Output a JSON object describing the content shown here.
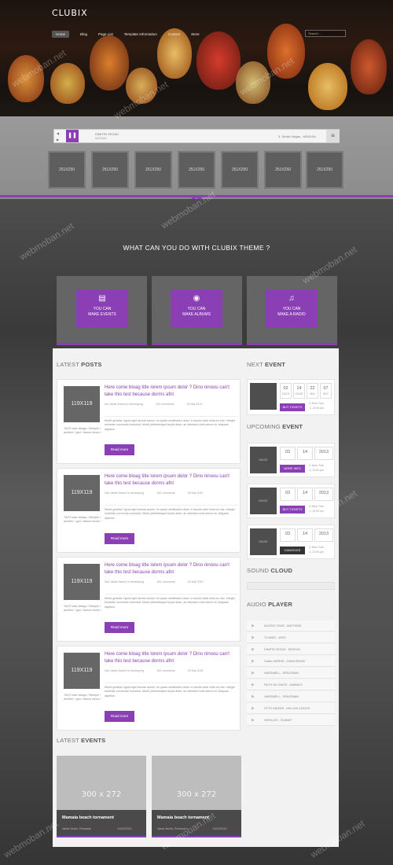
{
  "header": {
    "logo": "CLUBIX",
    "nav": [
      "Home",
      "Blog",
      "Page List",
      "Template Information",
      "Contact",
      "More"
    ],
    "search_placeholder": "Search..."
  },
  "player": {
    "artist": "DIMITRI VEGAS",
    "track": "MOGUAI",
    "now_playing": "3. Dimitri Vegas - MOGUAI"
  },
  "thumbs": [
    "251X250",
    "251X250",
    "251X250",
    "251X250",
    "251X250",
    "251X250",
    "251X250"
  ],
  "headline": "WHAT CAN YOU DO WITH CLUBIX THEME ?",
  "features": [
    {
      "icon": "news-icon",
      "line1": "YOU CAN",
      "line2": "MAKE EVENTS"
    },
    {
      "icon": "disc-icon",
      "line1": "YOU CAN",
      "line2": "MAKE ALBUMS"
    },
    {
      "icon": "music-note-icon",
      "line1": "YOU CAN",
      "line2": "MAKE A RADIO"
    }
  ],
  "latest_posts": {
    "heading_light": "LATEST",
    "heading_bold": "POSTS",
    "posts": [
      {
        "img": "119X119",
        "title": "Here come bloag title lorem ipsum dolor ? Dino ninoou can't take this test because dorms afnt",
        "author": "Ion Vasile Daniel in developing",
        "comments": "100 comments",
        "date": "25 Mai 2013",
        "text": "Morbi gravida, ligula eget lacinia auctor, mi quam vestibulum dolor, in iaculis ante nulla eu nisi. Integer molestie commodo euismod. Morbi pellentesque turpis diam, ac interdum erat rutrum et. Aliquam dapibus.",
        "tags": "TAGS web design / lifestyle / another / god / trance music /",
        "more": "Read more"
      },
      {
        "img": "119X119",
        "title": "Here come bloag title lorem ipsum dolor ? Dino ninoou can't take this test because dorms afnt",
        "author": "Sas Vasile Daniel in developing",
        "comments": "100 comments",
        "date": "25 Mai 2013",
        "text": "Morbi gravida, ligula eget lacinia auctor, mi quam vestibulum dolor, in iaculis ante nulla eu nisi. Integer molestie commodo euismod. Morbi pellentesque turpis diam, ac interdum erat rutrum et. Aliquam dapibus.",
        "tags": "TAGS web design / lifestyle / another / god / trance music /",
        "more": "Read more"
      },
      {
        "img": "119X119",
        "title": "Here come bloag title lorem ipsum dolor ? Dino ninoou can't take this test because dorms afnt",
        "author": "Sas Vasile Daniel in developing",
        "comments": "100 comments",
        "date": "25 Mai 2013",
        "text": "Morbi gravida, ligula eget lacinia auctor, mi quam vestibulum dolor, in iaculis ante nulla eu nisi. Integer molestie commodo euismod. Morbi pellentesque turpis diam, ac interdum erat rutrum et. Aliquam dapibus.",
        "tags": "TAGS web design / lifestyle / another / god / trance music /",
        "more": "Read more"
      },
      {
        "img": "119X119",
        "title": "Here come bloag title lorem ipsum dolor ? Dino ninoou can't take this test because dorms afnt",
        "author": "Sas Vasile Daniel in developing",
        "comments": "100 comments",
        "date": "25 Mai 2013",
        "text": "Morbi gravida, ligula eget lacinia auctor, mi quam vestibulum dolor, in iaculis ante nulla eu nisi. Integer molestie commodo euismod. Morbi pellentesque turpis diam, ac interdum erat rutrum et. Aliquam dapibus.",
        "tags": "TAGS web design / lifestyle / another / god / trance music /",
        "more": "Read more"
      }
    ]
  },
  "next_event": {
    "heading_light": "NEXT",
    "heading_bold": "EVENT",
    "countdown": [
      {
        "v": "02",
        "l": "DAYS"
      },
      {
        "v": "14",
        "l": "HOUR"
      },
      {
        "v": "22",
        "l": "MIN"
      },
      {
        "v": "07",
        "l": "SEC"
      }
    ],
    "button": "BUY TICKETS",
    "loc": "New York",
    "time": "12:00 pm"
  },
  "upcoming": {
    "heading_light": "UPCOMING",
    "heading_bold": "EVENT",
    "events": [
      {
        "img": "IMAGE",
        "day": "03",
        "month": "14",
        "year": "2013",
        "button": "MORE INFO",
        "loc": "New York",
        "time": "12:00 pm"
      },
      {
        "img": "IMAGE",
        "day": "03",
        "month": "14",
        "year": "2013",
        "button": "BUY TICKETS",
        "loc": "New York",
        "time": "12:00 pm"
      },
      {
        "img": "IMAGE",
        "day": "03",
        "month": "14",
        "year": "2013",
        "button": "CANCELED",
        "loc": "New York",
        "time": "12:00 pm"
      }
    ]
  },
  "soundcloud": {
    "heading_light": "SOUND",
    "heading_bold": "CLOUD"
  },
  "audio_player": {
    "heading_light": "AUDIO",
    "heading_bold": "PLAYER",
    "tracks": [
      "ALESSO YEAR - MATTHEW",
      "TUJAMO - WHO",
      "DIMITRI VEGAS - MOGUAI",
      "Calvin HARRIS - DAWN REMIX",
      "HARDWELL - SPACEMAN",
      "FAITH IN CHAOS - ANIMALS",
      "HARDWELL - SPACEMAN",
      "OTTO KNOWS - MILLION VOICES",
      "SKRILLEX - SUMMIT"
    ]
  },
  "latest_events": {
    "heading_light": "LATEST",
    "heading_bold": "EVENTS",
    "items": [
      {
        "img": "300 x 272",
        "title": "Mamaia beach tornament",
        "place": "Vama Veche, Romania",
        "date": "19/12/2013"
      },
      {
        "img": "300 x 272",
        "title": "Mamaia beach tornament",
        "place": "Vama Veche, Romania",
        "date": "19/12/2013"
      }
    ]
  },
  "watermark": "webmoban.net",
  "colors": {
    "accent": "#8a3fb5"
  }
}
